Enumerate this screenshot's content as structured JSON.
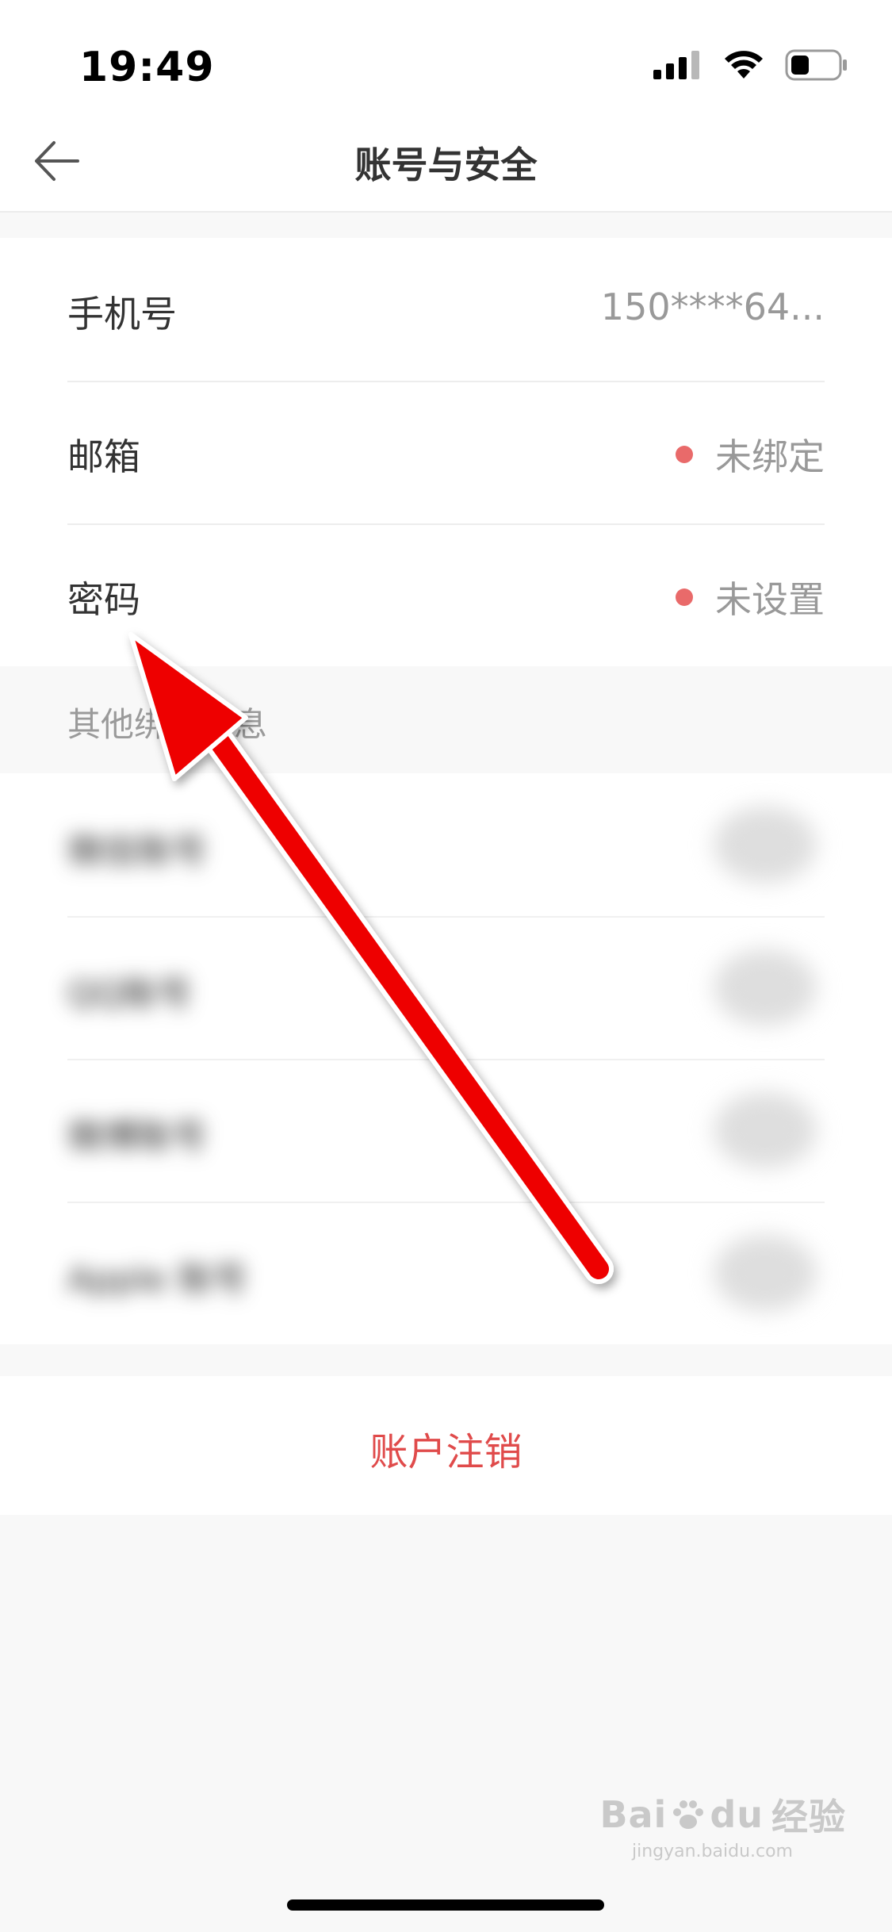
{
  "status_bar": {
    "time": "19:49"
  },
  "nav": {
    "title": "账号与安全"
  },
  "account_rows": [
    {
      "label": "手机号",
      "value": "150****64..."
    },
    {
      "label": "邮箱",
      "value": "未绑定"
    },
    {
      "label": "密码",
      "value": "未设置"
    }
  ],
  "section": {
    "label": "其他绑定信息"
  },
  "bindings": [
    {
      "label": "微信账号"
    },
    {
      "label": "QQ账号"
    },
    {
      "label": "微博账号"
    },
    {
      "label": "Apple 账号"
    }
  ],
  "logout": {
    "label": "账户注销"
  },
  "watermark": {
    "brand": "Bai",
    "brand_2": "du",
    "brand_cn": "经验",
    "site": "jingyan.baidu.com"
  },
  "colors": {
    "alert_dot": "#e96a6a",
    "logout_text": "#e04b4b",
    "arrow": "#ee0000"
  }
}
